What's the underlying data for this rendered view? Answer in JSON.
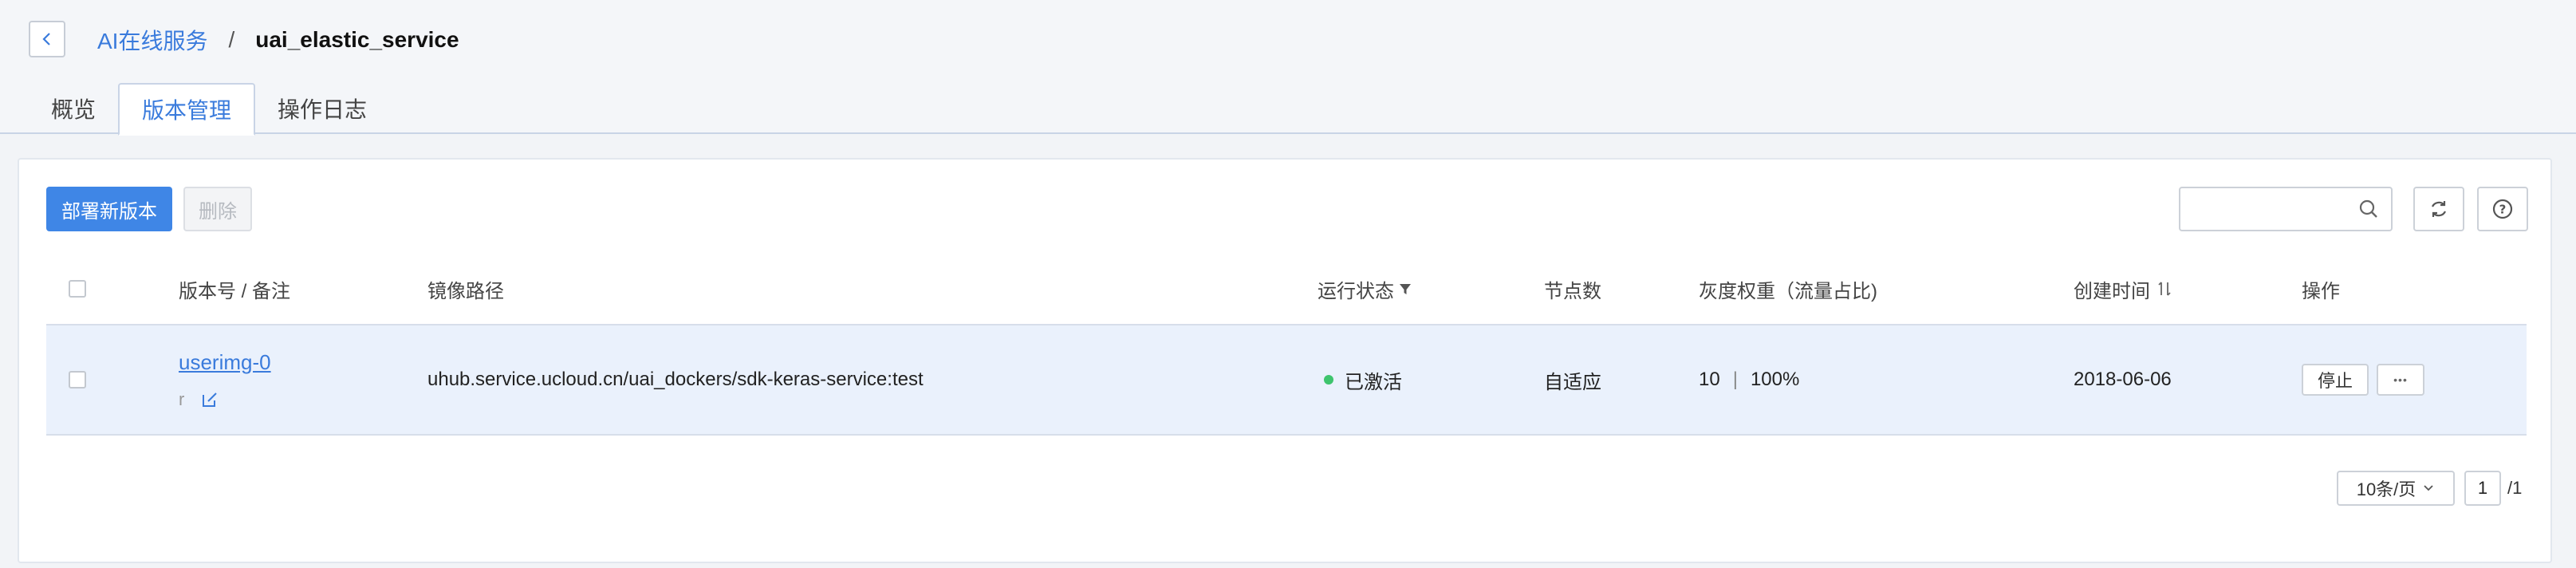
{
  "breadcrumb": {
    "parent": "AI在线服务",
    "separator": "/",
    "current": "uai_elastic_service"
  },
  "tabs": [
    {
      "label": "概览",
      "active": false
    },
    {
      "label": "版本管理",
      "active": true
    },
    {
      "label": "操作日志",
      "active": false
    }
  ],
  "toolbar": {
    "deploy_label": "部署新版本",
    "delete_label": "删除",
    "search_placeholder": "",
    "refresh_icon": "refresh-icon",
    "help_icon": "help-icon"
  },
  "table": {
    "columns": {
      "version": "版本号 / 备注",
      "image": "镜像路径",
      "status": "运行状态",
      "nodes": "节点数",
      "weight": "灰度权重（流量占比)",
      "created": "创建时间",
      "actions": "操作"
    },
    "rows": [
      {
        "version": "userimg-0",
        "note": "r",
        "image": "uhub.service.ucloud.cn/uai_dockers/sdk-keras-service:test",
        "status": "已激活",
        "nodes": "自适应",
        "weight_value": "10",
        "weight_sep": "|",
        "weight_percent": "100%",
        "created": "2018-06-06",
        "stop_label": "停止",
        "more_label": "•••"
      }
    ]
  },
  "pagination": {
    "page_size": "10条/页",
    "current_page": "1",
    "total": "/1"
  },
  "colors": {
    "primary": "#3f86e6",
    "link": "#3a7bdc",
    "status_active": "#3ec46d",
    "row_highlight": "#eaf1fc"
  }
}
